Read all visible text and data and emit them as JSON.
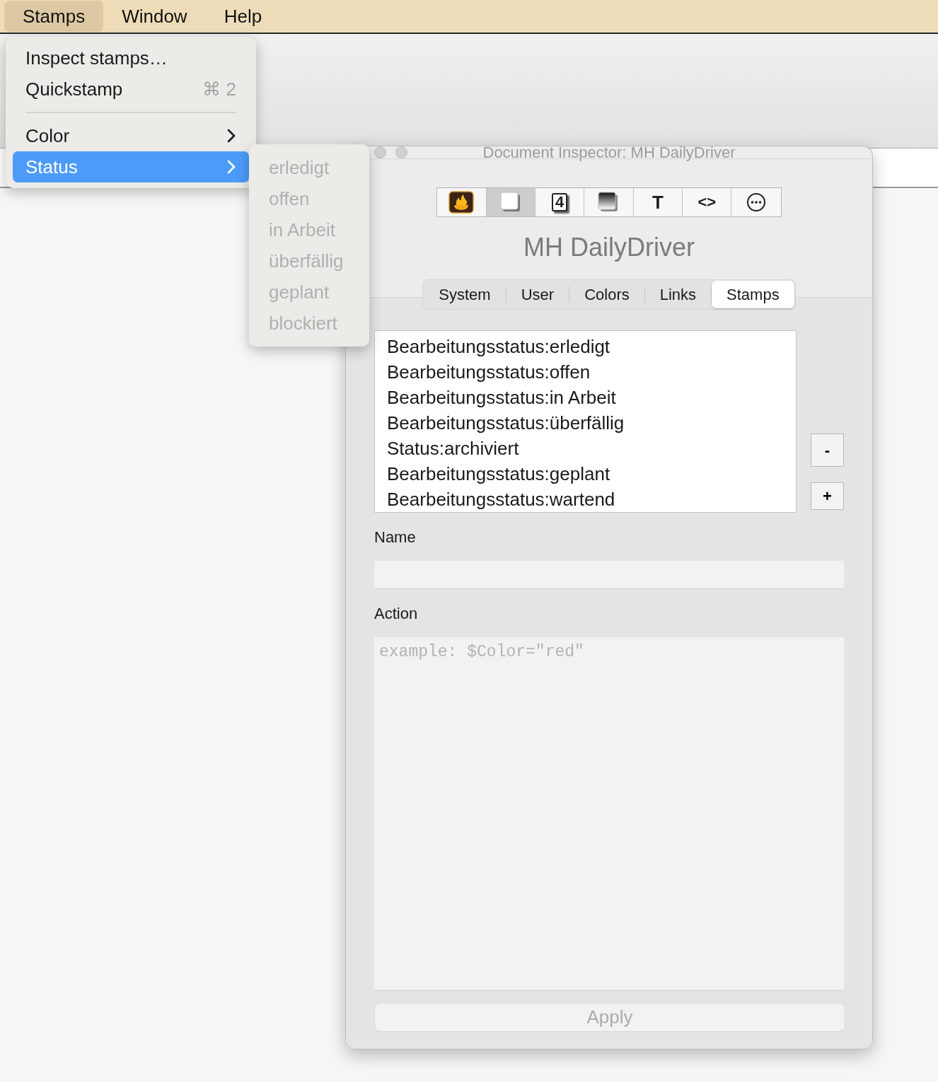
{
  "menu_bar": {
    "items": [
      {
        "label": "Stamps",
        "selected": true
      },
      {
        "label": "Window",
        "selected": false
      },
      {
        "label": "Help",
        "selected": false
      }
    ]
  },
  "menu": {
    "items": [
      {
        "kind": "item",
        "label": "Inspect stamps…",
        "selected": false
      },
      {
        "kind": "item",
        "label": "Quickstamp",
        "shortcut": "⌘ 2",
        "selected": false
      },
      {
        "kind": "separator"
      },
      {
        "kind": "submenu",
        "label": "Color",
        "selected": false
      },
      {
        "kind": "submenu",
        "label": "Status",
        "selected": true
      }
    ]
  },
  "submenu": {
    "items": [
      {
        "label": "erledigt",
        "disabled": true
      },
      {
        "label": "offen",
        "disabled": true
      },
      {
        "label": "in Arbeit",
        "disabled": true
      },
      {
        "label": "überfällig",
        "disabled": true
      },
      {
        "label": "geplant",
        "disabled": true
      },
      {
        "label": "blockiert",
        "disabled": true
      }
    ]
  },
  "window": {
    "title": "Document Inspector: MH DailyDriver",
    "toolbar": [
      {
        "kind": "app",
        "selected": false
      },
      {
        "kind": "note",
        "selected": true
      },
      {
        "kind": "number",
        "glyph": "4",
        "selected": false
      },
      {
        "kind": "shade",
        "selected": false
      },
      {
        "kind": "letter",
        "glyph": "T",
        "selected": false
      },
      {
        "kind": "code",
        "glyph": "<>",
        "selected": false
      },
      {
        "kind": "more",
        "selected": false
      }
    ],
    "heading": "MH DailyDriver",
    "tabs": [
      {
        "label": "System",
        "selected": false
      },
      {
        "label": "User",
        "selected": false
      },
      {
        "label": "Colors",
        "selected": false
      },
      {
        "label": "Links",
        "selected": false
      },
      {
        "label": "Stamps",
        "selected": true
      }
    ],
    "stamps": [
      "Bearbeitungsstatus:erledigt",
      "Bearbeitungsstatus:offen",
      "Bearbeitungsstatus:in Arbeit",
      "Bearbeitungsstatus:überfällig",
      "Status:archiviert",
      "Bearbeitungsstatus:geplant",
      "Bearbeitungsstatus:wartend"
    ],
    "remove_button": "-",
    "add_button": "+",
    "name_label": "Name",
    "action_label": "Action",
    "action_placeholder": "example: $Color=\"red\"",
    "apply_button": {
      "label": "Apply",
      "disabled": true
    }
  }
}
